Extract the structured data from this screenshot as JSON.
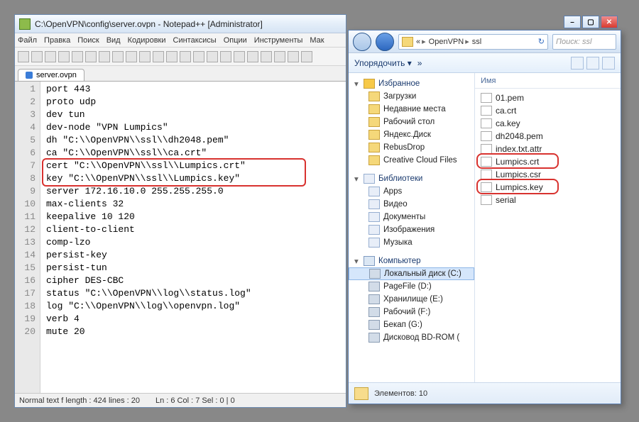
{
  "notepad": {
    "title": "C:\\OpenVPN\\config\\server.ovpn - Notepad++ [Administrator]",
    "menu": [
      "Файл",
      "Правка",
      "Поиск",
      "Вид",
      "Кодировки",
      "Синтаксисы",
      "Опции",
      "Инструменты",
      "Мак"
    ],
    "tab_label": "server.ovpn",
    "lines": [
      "port 443",
      "proto udp",
      "dev tun",
      "dev-node \"VPN Lumpics\"",
      "dh \"C:\\\\OpenVPN\\\\ssl\\\\dh2048.pem\"",
      "ca \"C:\\\\OpenVPN\\\\ssl\\\\ca.crt\"",
      "cert \"C:\\\\OpenVPN\\\\ssl\\\\Lumpics.crt\"",
      "key \"C:\\\\OpenVPN\\\\ssl\\\\Lumpics.key\"",
      "server 172.16.10.0 255.255.255.0",
      "max-clients 32",
      "keepalive 10 120",
      "client-to-client",
      "comp-lzo",
      "persist-key",
      "persist-tun",
      "cipher DES-CBC",
      "status \"C:\\\\OpenVPN\\\\log\\\\status.log\"",
      "log \"C:\\\\OpenVPN\\\\log\\\\openvpn.log\"",
      "verb 4",
      "mute 20"
    ],
    "status": {
      "left": "Normal text f length : 424    lines : 20",
      "mid": "Ln : 6   Col : 7   Sel : 0 | 0"
    },
    "highlight_lines": [
      7,
      8
    ]
  },
  "explorer": {
    "breadcrumb": [
      "«",
      "OpenVPN",
      "ssl"
    ],
    "search_placeholder": "Поиск: ssl",
    "organize_label": "Упорядочить ▾",
    "double_arrow": "»",
    "sidebar": {
      "favorites": {
        "header": "Избранное",
        "items": [
          "Загрузки",
          "Недавние места",
          "Рабочий стол",
          "Яндекс.Диск",
          "RebusDrop",
          "Creative Cloud Files"
        ]
      },
      "libraries": {
        "header": "Библиотеки",
        "items": [
          "Apps",
          "Видео",
          "Документы",
          "Изображения",
          "Музыка"
        ]
      },
      "computer": {
        "header": "Компьютер",
        "items": [
          "Локальный диск (C:)",
          "PageFile (D:)",
          "Хранилище (E:)",
          "Рабочий (F:)",
          "Бекап (G:)",
          "Дисковод BD-ROM ("
        ]
      }
    },
    "files_header": "Имя",
    "files": [
      "01.pem",
      "ca.crt",
      "ca.key",
      "dh2048.pem",
      "index.txt.attr",
      "Lumpics.crt",
      "Lumpics.csr",
      "Lumpics.key",
      "serial"
    ],
    "highlight_files": [
      "Lumpics.crt",
      "Lumpics.key"
    ],
    "status_count": "Элементов: 10"
  }
}
